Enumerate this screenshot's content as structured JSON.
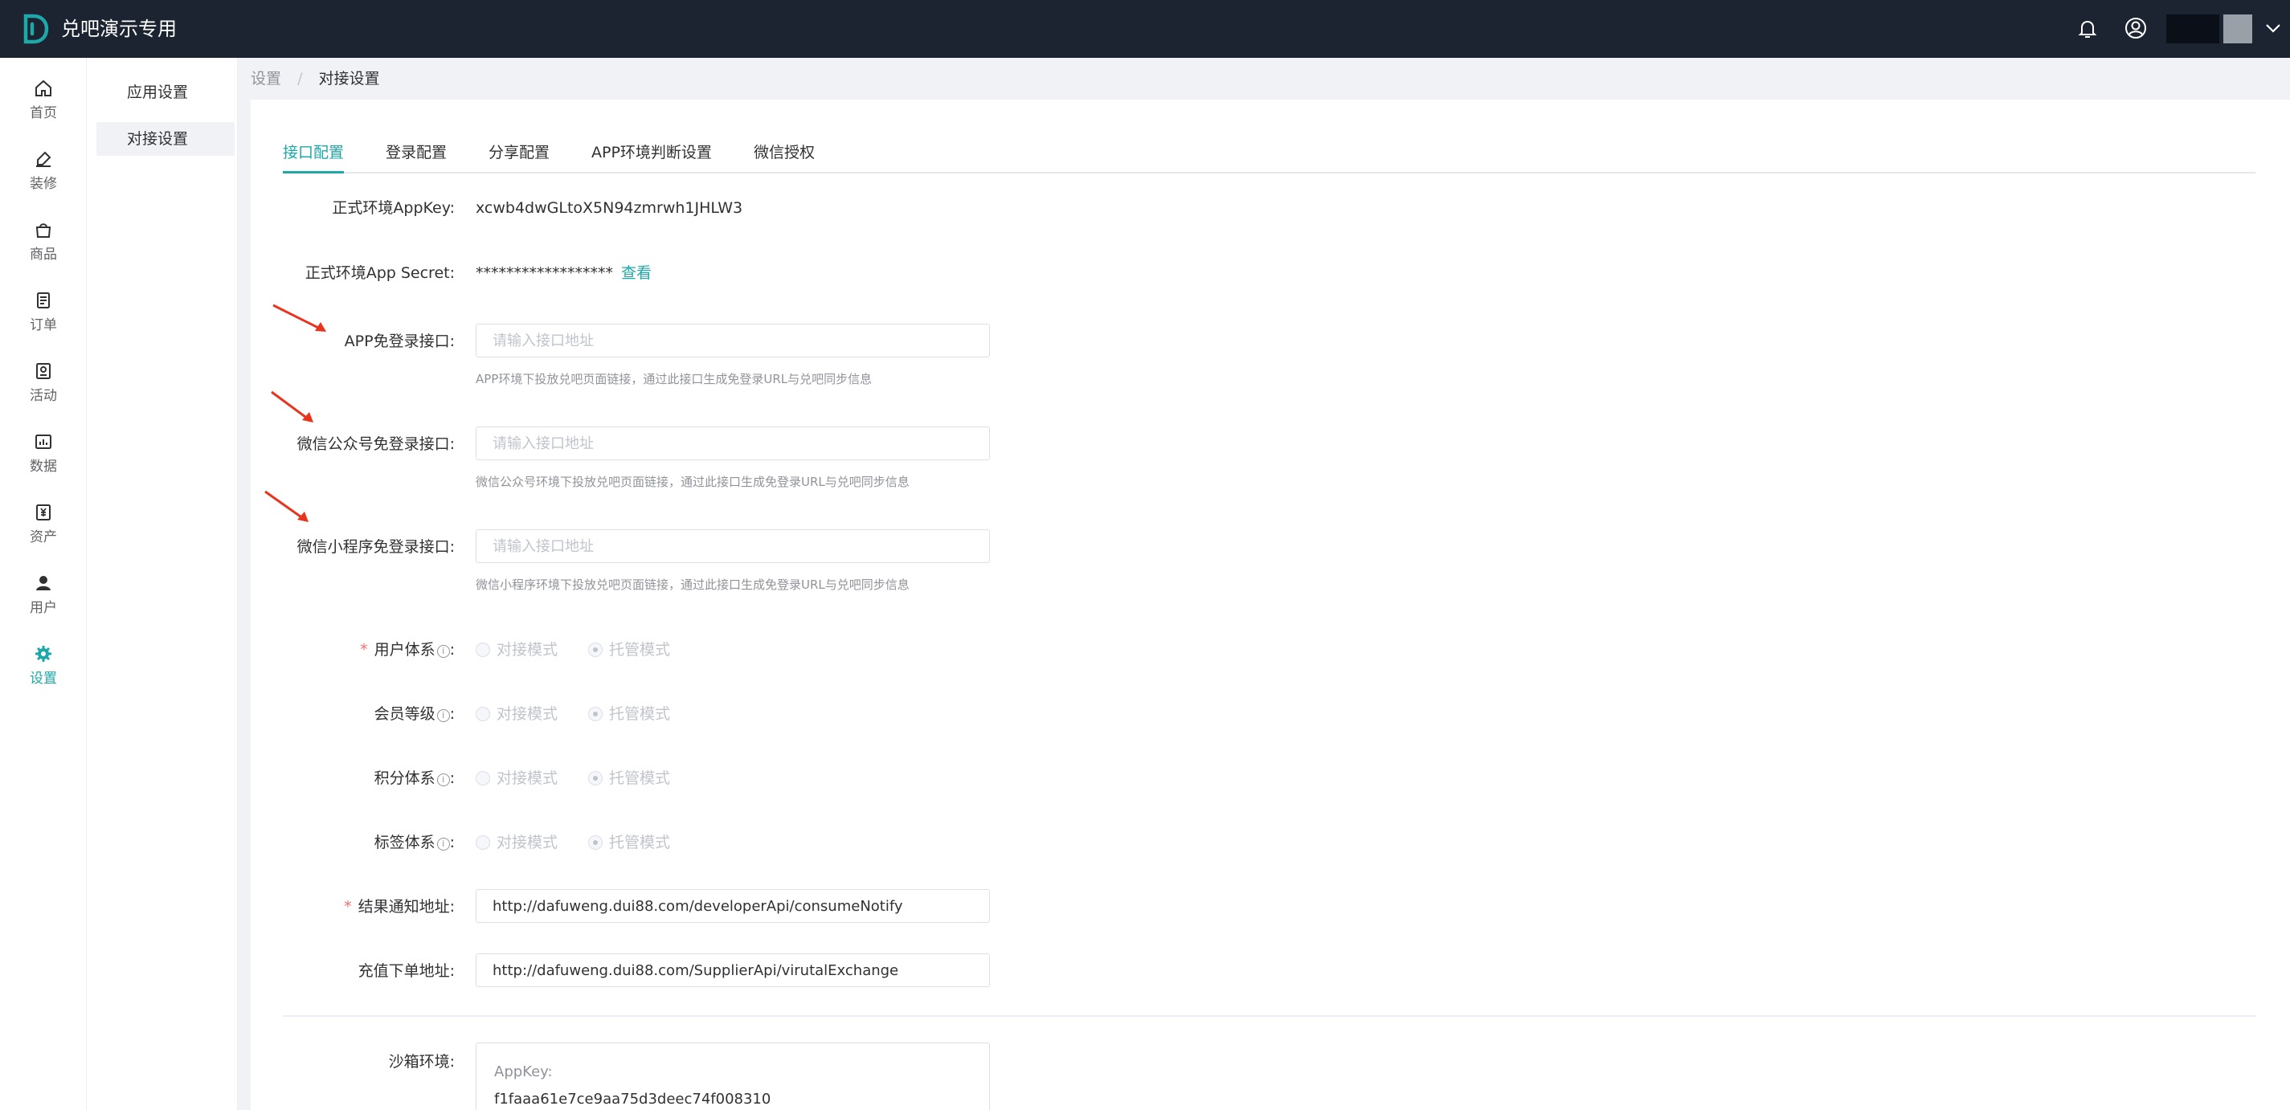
{
  "app": {
    "title": "兑吧演示专用"
  },
  "colors": {
    "accent": "#1fa8a8",
    "topbar": "#1c2431",
    "required": "#f56c6c",
    "arrow": "#e8341c"
  },
  "sidebar": {
    "items": [
      {
        "label": "首页",
        "icon": "home-icon"
      },
      {
        "label": "装修",
        "icon": "brush-icon"
      },
      {
        "label": "商品",
        "icon": "bag-icon"
      },
      {
        "label": "订单",
        "icon": "order-icon"
      },
      {
        "label": "活动",
        "icon": "activity-icon"
      },
      {
        "label": "数据",
        "icon": "chart-icon"
      },
      {
        "label": "资产",
        "icon": "yuan-icon"
      },
      {
        "label": "用户",
        "icon": "user-icon"
      },
      {
        "label": "设置",
        "icon": "gear-icon",
        "active": true
      }
    ]
  },
  "submenu": {
    "items": [
      {
        "label": "应用设置"
      },
      {
        "label": "对接设置",
        "active": true
      }
    ]
  },
  "breadcrumb": {
    "root": "设置",
    "sep": "/",
    "current": "对接设置"
  },
  "tabs": [
    {
      "label": "接口配置",
      "active": true
    },
    {
      "label": "登录配置"
    },
    {
      "label": "分享配置"
    },
    {
      "label": "APP环境判断设置"
    },
    {
      "label": "微信授权"
    }
  ],
  "form": {
    "appkey": {
      "label": "正式环境AppKey:",
      "value": "xcwb4dwGLtoX5N94zmrwh1JHLW3"
    },
    "secret": {
      "label": "正式环境App Secret:",
      "value": "******************",
      "link": "查看"
    },
    "app_login": {
      "label": "APP免登录接口:",
      "placeholder": "请输入接口地址",
      "hint": "APP环境下投放兑吧页面链接，通过此接口生成免登录URL与兑吧同步信息"
    },
    "wx_mp_login": {
      "label": "微信公众号免登录接口:",
      "placeholder": "请输入接口地址",
      "hint": "微信公众号环境下投放兑吧页面链接，通过此接口生成免登录URL与兑吧同步信息"
    },
    "wx_mini_login": {
      "label": "微信小程序免登录接口:",
      "placeholder": "请输入接口地址",
      "hint": "微信小程序环境下投放兑吧页面链接，通过此接口生成免登录URL与兑吧同步信息"
    },
    "user_system": {
      "required": "*",
      "label": "用户体系",
      "info": "i",
      "colon": ":",
      "opt1": "对接模式",
      "opt2": "托管模式"
    },
    "member_level": {
      "label": "会员等级",
      "info": "i",
      "colon": ":",
      "opt1": "对接模式",
      "opt2": "托管模式"
    },
    "points_system": {
      "label": "积分体系",
      "info": "i",
      "colon": ":",
      "opt1": "对接模式",
      "opt2": "托管模式"
    },
    "tag_system": {
      "label": "标签体系",
      "info": "i",
      "colon": ":",
      "opt1": "对接模式",
      "opt2": "托管模式"
    },
    "notify_url": {
      "required": "*",
      "label": "结果通知地址:",
      "value": "http://dafuweng.dui88.com/developerApi/consumeNotify"
    },
    "recharge_url": {
      "label": "充值下单地址:",
      "value": "http://dafuweng.dui88.com/SupplierApi/virutalExchange"
    },
    "sandbox": {
      "label": "沙箱环境:",
      "key_label": "AppKey:",
      "key_value": "f1faaa61e7ce9aa75d3deec74f008310"
    }
  }
}
